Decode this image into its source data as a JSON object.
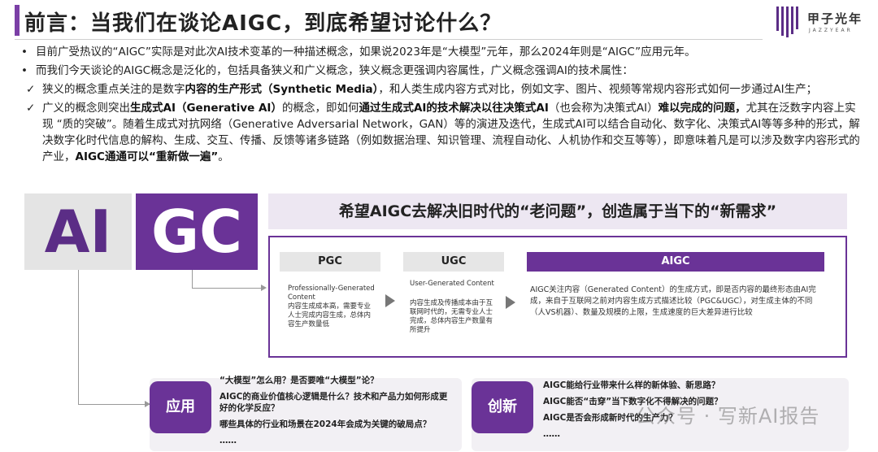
{
  "title": "前言：当我们在谈论AIGC，到底希望讨论什么？",
  "logo": {
    "cn": "甲子光年",
    "en": "JAZZYEAR"
  },
  "bullets": {
    "b1": "目前广受热议的“AIGC”实际是对此次AI技术变革的一种描述概念，如果说2023年是“大模型”元年，那么2024年则是“AIGC”应用元年。",
    "b2": "而我们今天谈论的AIGC概念是泛化的，包括具备狭义和广义概念，狭义概念更强调内容属性，广义概念强调AI的技术属性：",
    "c1_pre": "狭义的概念重点关注的是数字",
    "c1_bold": "内容的生产形式（Synthetic Media）",
    "c1_post": "，和人类生成内容方式对比，例如文字、图片、视频等常规内容形式如何一步通过AI生产；",
    "c2_pre": "广义的概念则突出",
    "c2_bold1": "生成式AI（Generative AI）",
    "c2_mid1": "的概念，即如何",
    "c2_bold2": "通过生成式AI的技术解决以往决策式AI",
    "c2_mid2": "（也会称为决策式AI）",
    "c2_bold3": "难以完成的问题，",
    "c2_mid3": "尤其在泛数字内容上实现 “质的突破”",
    "c2_mid4": "。随着生成式对抗网络（Generative Adversarial Network，GAN）等的演进及迭代，生成式AI可以结合自动化、数字化、决策式AI等等多种的形式，解决数字化时代信息的解构、生成、交互、传播、反馈等诸多链路（例如数据治理、知识管理、流程自动化、人机协作和交互等等），即意味着凡是可以涉及数字内容形式的产业，",
    "c2_bold4": "AIGC通通可以“重新做一遍”",
    "c2_end": "。",
    "check_mark": "✓"
  },
  "block": {
    "ai": "AI",
    "gc": "GC",
    "headline": "希望AIGC去解决旧时代的“老问题”，创造属于当下的“新需求”"
  },
  "pgc": {
    "label": "PGC",
    "en": "Professionally-Generated Content",
    "desc": "内容生成成本高，需要专业人士完成内容生成，总体内容生产数量低"
  },
  "ugc": {
    "label": "UGC",
    "en": "User-Generated Content",
    "desc": "内容生成及传播成本由于互联网时代的，无需专业人士完成，总体内容生产数量有所提升"
  },
  "aigc": {
    "label": "AIGC",
    "desc": "AIGC关注内容（Generated Content）的生成方式，即是否内容的最终形态由AI完成，来自于互联网之前对内容生成方式描述比较（PGC&UGC），对生成主体的不同（人VS机器）、数量及规模的上限，生成速度的巨大差异进行比较"
  },
  "app": {
    "label": "应用",
    "q1": "“大模型”怎么用？是否要唯“大模型”论？",
    "q2": "AIGC的商业价值核心逻辑是什么？技术和产品力如何形成更好的化学反应？",
    "q3": "哪些具体的行业和场景在2024年会成为关键的破局点？",
    "q4": "……"
  },
  "innov": {
    "label": "创新",
    "q1": "AIGC能给行业带来什么样的新体验、新思路？",
    "q2": "AIGC能否“击穿”当下数字化不得解决的问题？",
    "q3": "AIGC是否会形成新时代的生产力？",
    "q4": "……"
  },
  "watermark": "公众号 · 写新AI报告"
}
